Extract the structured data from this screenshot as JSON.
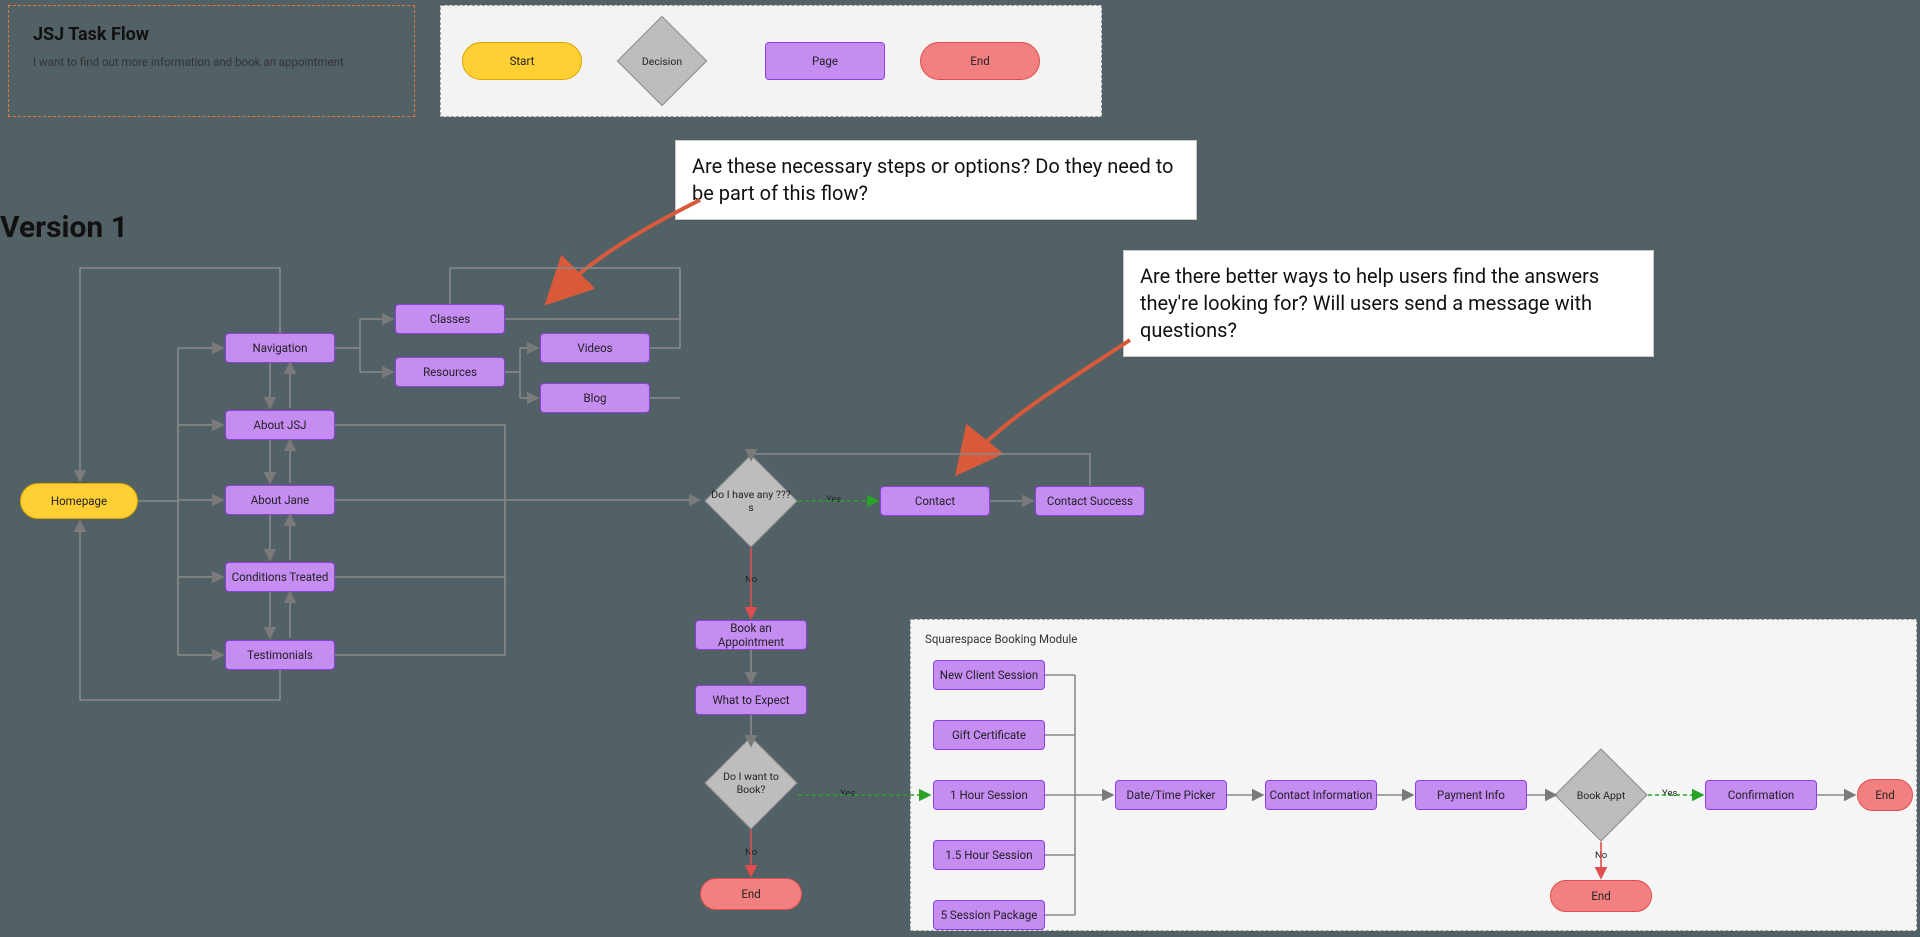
{
  "header_box": {
    "title": "JSJ Task Flow",
    "subtitle": "I want to find out more information and book an appointment"
  },
  "legend": {
    "start": "Start",
    "decision": "Decision",
    "page": "Page",
    "end": "End"
  },
  "version_label": "Version 1",
  "comments": {
    "c1": "Are these necessary steps or options? Do they need to be part of this flow?",
    "c2": "Are there better ways to help users find the answers they're looking for? Will users send a message with questions?"
  },
  "nodes": {
    "homepage": "Homepage",
    "navigation": "Navigation",
    "about_jsj": "About JSJ",
    "about_jane": "About Jane",
    "conditions": "Conditions Treated",
    "testimonials": "Testimonials",
    "classes": "Classes",
    "resources": "Resources",
    "videos": "Videos",
    "blog": "Blog",
    "decision_questions": "Do I have any ???s",
    "contact": "Contact",
    "contact_success": "Contact Success",
    "book_appt": "Book an Appointment",
    "what_to_expect": "What to Expect",
    "decision_book": "Do I want to Book?",
    "end1": "End",
    "new_client": "New Client Session",
    "gift_cert": "Gift Certificate",
    "hour1": "1 Hour Session",
    "hour15": "1.5 Hour Session",
    "pkg5": "5 Session Package",
    "datetime": "Date/Time Picker",
    "contact_info": "Contact Information",
    "payment": "Payment Info",
    "decision_bookappt": "Book Appt",
    "confirmation": "Confirmation",
    "end2": "End",
    "end3": "End"
  },
  "module_title": "Squarespace Booking Module",
  "edge_labels": {
    "yes": "Yes",
    "no": "No"
  },
  "colors": {
    "start_fill": "#ffcf33",
    "page_fill": "#c58cf2",
    "end_fill": "#f38080",
    "decision_fill": "#bdbdbd",
    "arrow_gray": "#7a7a7a",
    "arrow_green": "#2aa32a",
    "arrow_red": "#e04d4d",
    "comment_arrow": "#d85a3a"
  }
}
